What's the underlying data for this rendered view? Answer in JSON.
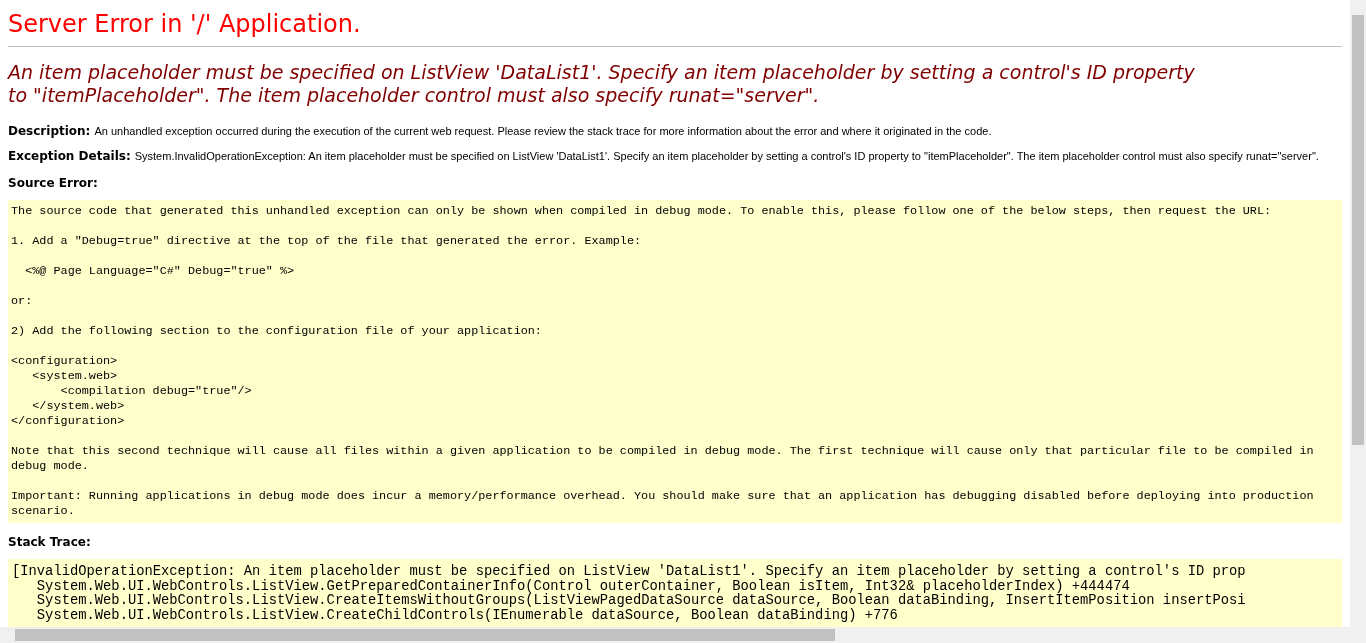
{
  "title": "Server Error in '/' Application.",
  "message": "An item placeholder must be specified on ListView 'DataList1'. Specify an item placeholder by setting a control's ID property to \"itemPlaceholder\". The item placeholder control must also specify runat=\"server\".",
  "description": {
    "label": "Description:",
    "text": "An unhandled exception occurred during the execution of the current web request. Please review the stack trace for more information about the error and where it originated in the code."
  },
  "exception_details": {
    "label": "Exception Details:",
    "text": "System.InvalidOperationException: An item placeholder must be specified on ListView 'DataList1'. Specify an item placeholder by setting a control's ID property to \"itemPlaceholder\". The item placeholder control must also specify runat=\"server\"."
  },
  "source_error": {
    "label": "Source Error:",
    "blocks": [
      "The source code that generated this unhandled exception can only be shown when compiled in debug mode. To enable this, please follow one of the below steps, then request the URL:",
      "1. Add a \"Debug=true\" directive at the top of the file that generated the error. Example:",
      "  <%@ Page Language=\"C#\" Debug=\"true\" %>",
      "or:",
      "2) Add the following section to the configuration file of your application:",
      "<configuration>\n   <system.web>\n       <compilation debug=\"true\"/>\n   </system.web>\n</configuration>",
      "Note that this second technique will cause all files within a given application to be compiled in debug mode. The first technique will cause only that particular file to be compiled in\ndebug mode.",
      "Important: Running applications in debug mode does incur a memory/performance overhead. You should make sure that an application has debugging disabled before deploying into production\nscenario."
    ]
  },
  "stack_trace": {
    "label": "Stack Trace:",
    "lines": [
      "[InvalidOperationException: An item placeholder must be specified on ListView 'DataList1'. Specify an item placeholder by setting a control's ID prop",
      "   System.Web.UI.WebControls.ListView.GetPreparedContainerInfo(Control outerContainer, Boolean isItem, Int32& placeholderIndex) +444474",
      "   System.Web.UI.WebControls.ListView.CreateItemsWithoutGroups(ListViewPagedDataSource dataSource, Boolean dataBinding, InsertItemPosition insertPosi",
      "   System.Web.UI.WebControls.ListView.CreateChildControls(IEnumerable dataSource, Boolean dataBinding) +776"
    ]
  }
}
